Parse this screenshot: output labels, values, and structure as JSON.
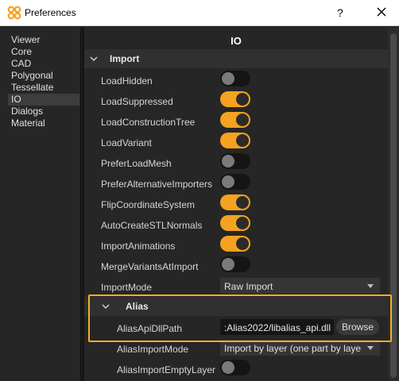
{
  "window": {
    "title": "Preferences",
    "help_label": "?"
  },
  "sidebar": {
    "items": [
      {
        "label": "Viewer"
      },
      {
        "label": "Core"
      },
      {
        "label": "CAD"
      },
      {
        "label": "Polygonal"
      },
      {
        "label": "Tessellate"
      },
      {
        "label": "IO",
        "selected": true
      },
      {
        "label": "Dialogs"
      },
      {
        "label": "Material"
      }
    ]
  },
  "page": {
    "title": "IO"
  },
  "import_section": {
    "label": "Import",
    "properties": [
      {
        "label": "LoadHidden",
        "type": "toggle",
        "value": false
      },
      {
        "label": "LoadSuppressed",
        "type": "toggle",
        "value": true
      },
      {
        "label": "LoadConstructionTree",
        "type": "toggle",
        "value": true
      },
      {
        "label": "LoadVariant",
        "type": "toggle",
        "value": true
      },
      {
        "label": "PreferLoadMesh",
        "type": "toggle",
        "value": false
      },
      {
        "label": "PreferAlternativeImporters",
        "type": "toggle",
        "value": false
      },
      {
        "label": "FlipCoordinateSystem",
        "type": "toggle",
        "value": true
      },
      {
        "label": "AutoCreateSTLNormals",
        "type": "toggle",
        "value": true
      },
      {
        "label": "ImportAnimations",
        "type": "toggle",
        "value": true
      },
      {
        "label": "MergeVariantsAtImport",
        "type": "toggle",
        "value": false
      }
    ],
    "import_mode": {
      "label": "ImportMode",
      "value": "Raw  Import"
    }
  },
  "alias_section": {
    "label": "Alias",
    "api_dll_path": {
      "label": "AliasApiDllPath",
      "value": ":Alias2022/libalias_api.dll",
      "browse_label": "Browse"
    },
    "import_mode": {
      "label": "AliasImportMode",
      "value": "Import by layer (one part by layer"
    },
    "import_empty_layer": {
      "label": "AliasImportEmptyLayer",
      "value": false
    }
  },
  "colors": {
    "accent": "#f4a21f",
    "highlight_border": "#f4b21f",
    "background": "#262626"
  },
  "icons": {
    "app": "puzzle-knot-icon",
    "close": "close-icon",
    "expand": "chevron-down-icon"
  }
}
